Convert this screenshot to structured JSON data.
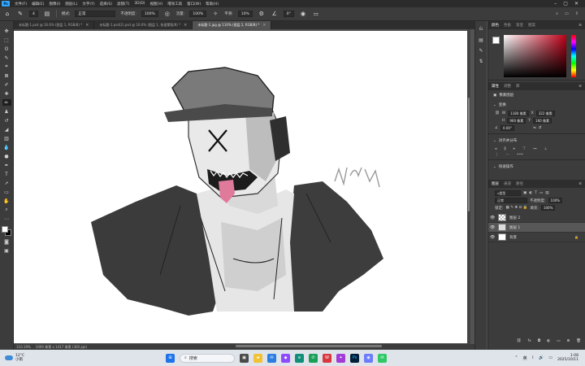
{
  "menu": {
    "app_logo": "Ps",
    "items": [
      "文件(F)",
      "编辑(E)",
      "图像(I)",
      "图层(L)",
      "文字(Y)",
      "选择(S)",
      "滤镜(T)",
      "3D(D)",
      "视图(V)",
      "增效工具",
      "窗口(W)",
      "帮助(H)"
    ],
    "window_controls": [
      "–",
      "▢",
      "✕"
    ]
  },
  "options": {
    "mode_label": "模式:",
    "mode_value": "正常",
    "opacity_label": "不透明度:",
    "opacity_value": "100%",
    "flow_label": "流量:",
    "flow_value": "100%",
    "smooth_label": "平滑:",
    "smooth_value": "10%",
    "angle_value": "0°",
    "brush_size": "4"
  },
  "tabs": [
    {
      "label": "未标题-1.psd @ 16.6% (图层 1, RGB/8) *",
      "active": false
    },
    {
      "label": "未标题-1.psd(2).psd @ 16.6% (图层 1, 快速蒙版/8) *",
      "active": false
    },
    {
      "label": "未标题-1.jpg @ 110% (图层 2, RGB/8) *",
      "active": true
    }
  ],
  "status": {
    "zoom": "110.19%",
    "doc_info": "1000 像素 x 1417 像素 (300 ppi)"
  },
  "colors": {
    "foreground": "#ffffff",
    "background": "#000000",
    "accent": "#31a8ff"
  },
  "panels": {
    "color_tabs": [
      "颜色",
      "色板",
      "渐变",
      "图案"
    ],
    "props_tabs": [
      "属性",
      "调整",
      "库"
    ],
    "props_doc_label": "像素图层",
    "transform_title": "变换",
    "transform": {
      "w": "1180 像素",
      "x": "322 像素",
      "h": "960 像素",
      "y": "160 像素",
      "angle": "0.00°"
    },
    "align_title": "对齐并分布",
    "quick_title": "快速操作",
    "layers_tabs": [
      "图层",
      "通道",
      "路径"
    ],
    "layer_filter": "类型",
    "blend_mode": "正常",
    "opacity_label": "不透明度:",
    "opacity_value": "100%",
    "lock_label": "锁定:",
    "fill_label": "填充:",
    "fill_value": "100%",
    "layers": [
      {
        "name": "图层 2",
        "selected": false,
        "thumb": "check"
      },
      {
        "name": "图层 1",
        "selected": true,
        "thumb": "art"
      },
      {
        "name": "背景",
        "selected": false,
        "thumb": "white",
        "locked": true
      }
    ]
  },
  "taskbar": {
    "weather_temp": "12°C",
    "weather_desc": "小雨",
    "search_placeholder": "搜索",
    "ime": "英",
    "time": "1:08",
    "date": "2025/10/11"
  },
  "signature_text": "NYA"
}
